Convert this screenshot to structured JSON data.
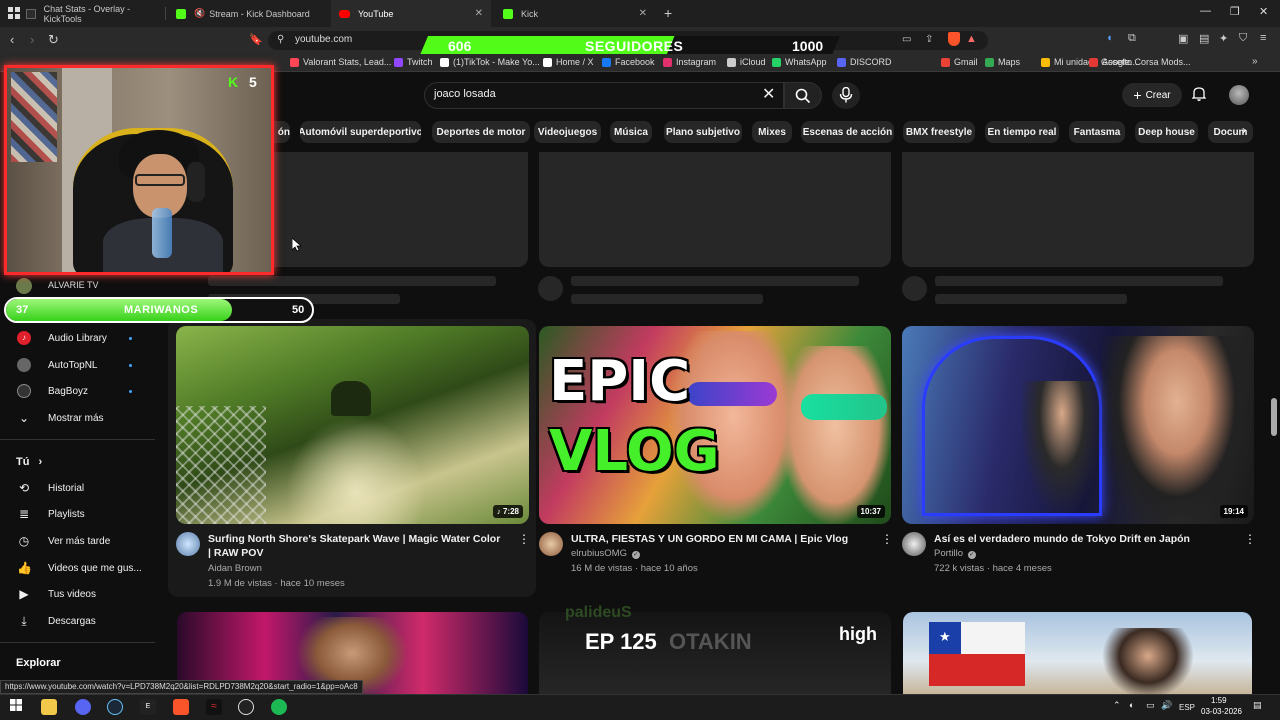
{
  "tabs": [
    {
      "title": "Chat Stats - Overlay - KickTools",
      "active": false
    },
    {
      "title": "Stream - Kick Dashboard",
      "active": false
    },
    {
      "title": "YouTube",
      "active": true
    },
    {
      "title": "Kick",
      "active": false
    }
  ],
  "new_tab": "+",
  "address": {
    "url": "youtube.com"
  },
  "bookmarks": [
    {
      "label": "Valorant Stats, Lead...",
      "color": "#ff4655"
    },
    {
      "label": "Twitch",
      "color": "#9146ff"
    },
    {
      "label": "(1)TikTok - Make Yo...",
      "color": "#ffffff"
    },
    {
      "label": "Home / X",
      "color": "#ffffff"
    },
    {
      "label": "Facebook",
      "color": "#1877f2"
    },
    {
      "label": "Instagram",
      "color": "#e1306c"
    },
    {
      "label": "iCloud",
      "color": "#cccccc"
    },
    {
      "label": "WhatsApp",
      "color": "#25d366"
    },
    {
      "label": "DISCORD",
      "color": "#5865f2"
    },
    {
      "label": "Gmail",
      "color": "#ea4335"
    },
    {
      "label": "Maps",
      "color": "#34a853"
    },
    {
      "label": "Mi unidad - Google...",
      "color": "#fbbc04"
    },
    {
      "label": "Assetto Corsa Mods...",
      "color": "#e53935"
    }
  ],
  "followers_overlay": {
    "current": "606",
    "label": "SEGUIDORES",
    "goal": "1000",
    "progress": 0.606,
    "fill_color": "#53fc18"
  },
  "search": {
    "query": "joaco losada"
  },
  "header": {
    "create_label": "Crear"
  },
  "chips": [
    "ón",
    "Automóvil superdeportivo",
    "Deportes de motor",
    "Videojuegos",
    "Música",
    "Plano subjetivo",
    "Mixes",
    "Escenas de acción",
    "BMX freestyle",
    "En tiempo real",
    "Fantasma",
    "Deep house",
    "Docum"
  ],
  "webcam": {
    "k_count": "5"
  },
  "mariwanos": {
    "current": "37",
    "label": "MARIWANOS",
    "goal": "50",
    "progress": 0.74
  },
  "sidebar": {
    "partial_item": "ALVARIE TV",
    "subs": [
      {
        "label": "Audio Library",
        "color": "#e0202a"
      },
      {
        "label": "AutoTopNL",
        "color": "#666666"
      },
      {
        "label": "BagBoyz",
        "color": "#333333"
      }
    ],
    "show_more": "Mostrar más",
    "you_title": "Tú",
    "you_items": [
      "Historial",
      "Playlists",
      "Ver más tarde",
      "Videos que me gus...",
      "Tus videos",
      "Descargas"
    ],
    "explore_title": "Explorar"
  },
  "videos": [
    {
      "title": "Surfing North Shore's Skatepark Wave | Magic Water Color | RAW POV",
      "channel": "Aidan Brown",
      "verified": false,
      "meta": "1.9 M de vistas · hace 10 meses",
      "duration": "7:28",
      "duration_prefix": "♪"
    },
    {
      "title": "ULTRA, FIESTAS Y UN GORDO EN MI CAMA | Epic Vlog",
      "channel": "elrubiusOMG",
      "verified": true,
      "meta": "16 M de vistas · hace 10 años",
      "duration": "10:37",
      "thumb_text_1": "EPIC",
      "thumb_text_2": "VLOG"
    },
    {
      "title": "Así es el verdadero mundo de Tokyo Drift en Japón",
      "channel": "Portillo",
      "verified": true,
      "meta": "722 k vistas · hace 4 meses",
      "duration": "19:14"
    }
  ],
  "bottom_thumbs": {
    "ep_label": "EP 125",
    "ep_sub": "OTAKIN",
    "high_label": "high",
    "partial_logo": "palideuS"
  },
  "status_url": "https://www.youtube.com/watch?v=LPD738M2q20&list=RDLPD738M2q20&start_radio=1&pp=oAc8",
  "taskbar": {
    "lang": "ESP",
    "time": "1:59",
    "date": "03-03-2026"
  }
}
